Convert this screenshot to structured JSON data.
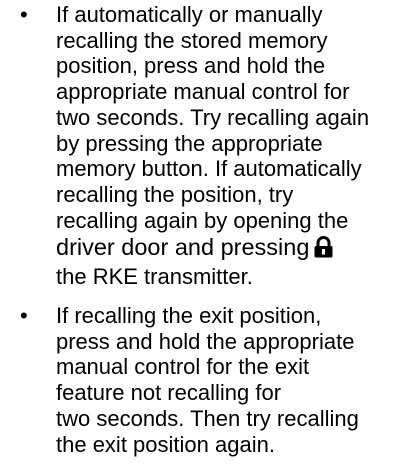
{
  "bullet_glyph": "•",
  "items": [
    {
      "lines": [
        "If automatically or manually",
        "recalling the stored memory",
        "position, press and hold the",
        "appropriate manual control for",
        "two seconds. Try recalling again",
        "by pressing the appropriate",
        "memory button. If automatically",
        "recalling the position, try",
        "recalling again by opening the"
      ],
      "icon_line_before": "driver door and pressing",
      "icon": "lock-icon",
      "last_line": "the RKE transmitter."
    },
    {
      "lines": [
        "If recalling the exit position,",
        "press and hold the appropriate",
        "manual control for the exit",
        "feature not recalling for",
        "two seconds. Then try recalling",
        "the exit position again."
      ]
    }
  ]
}
